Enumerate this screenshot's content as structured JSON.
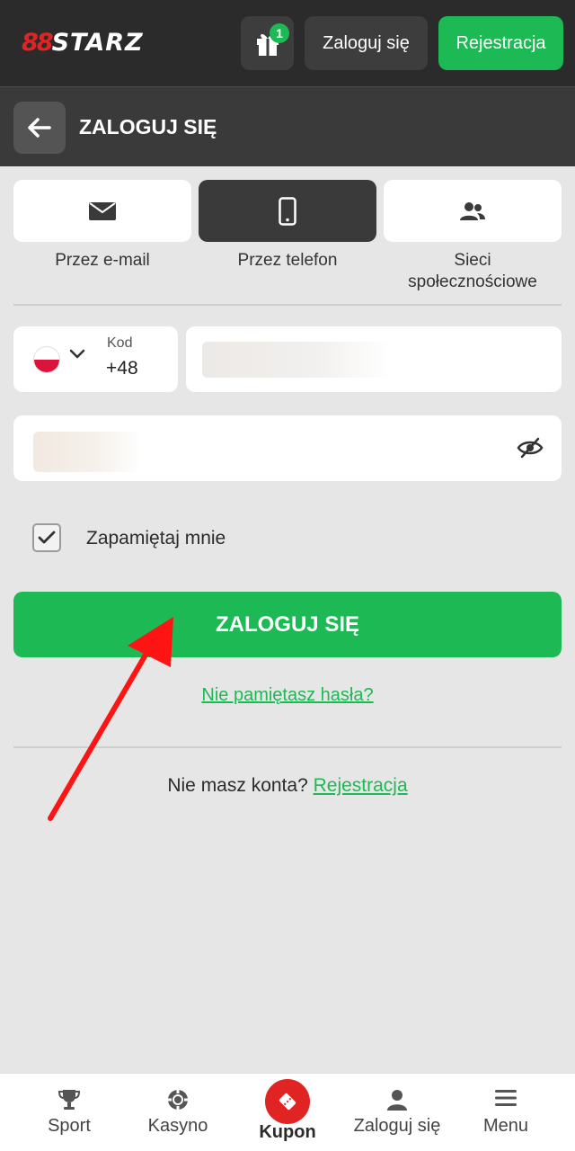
{
  "header": {
    "logo_mark": "88",
    "logo_text": "STARZ",
    "gift_count": "1",
    "login_label": "Zaloguj się",
    "register_label": "Rejestracja"
  },
  "subheader": {
    "title": "ZALOGUJ SIĘ"
  },
  "methods": [
    {
      "label": "Przez e-mail",
      "icon": "envelope-icon",
      "active": false
    },
    {
      "label": "Przez telefon",
      "icon": "phone-icon",
      "active": true
    },
    {
      "label": "Sieci\nspołecznościowe",
      "icon": "users-icon",
      "active": false
    }
  ],
  "phone": {
    "code_label": "Kod",
    "code_value": "+48",
    "country_flag": "poland-flag-icon"
  },
  "remember": {
    "label": "Zapamiętaj mnie",
    "checked": true
  },
  "submit_label": "ZALOGUJ SIĘ",
  "forgot_label": "Nie pamiętasz hasła?",
  "no_account": {
    "text": "Nie masz konta?",
    "link": "Rejestracja"
  },
  "nav": [
    {
      "label": "Sport",
      "icon": "trophy-icon"
    },
    {
      "label": "Kasyno",
      "icon": "casino-chip-icon"
    },
    {
      "label": "Kupon",
      "icon": "ticket-icon"
    },
    {
      "label": "Zaloguj się",
      "icon": "user-icon"
    },
    {
      "label": "Menu",
      "icon": "hamburger-icon"
    }
  ],
  "colors": {
    "accent": "#1db954",
    "brand_red": "#e02424",
    "header_bg": "#2b2b2b",
    "page_bg": "#e6e6e6"
  }
}
